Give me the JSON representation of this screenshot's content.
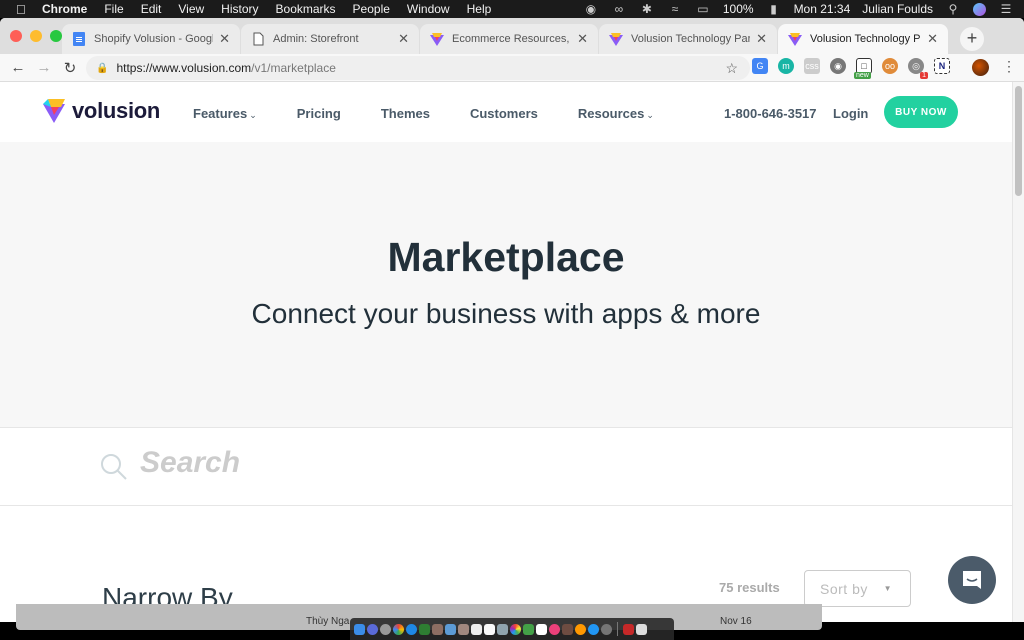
{
  "menubar": {
    "app_name": "Chrome",
    "menus": [
      "File",
      "Edit",
      "View",
      "History",
      "Bookmarks",
      "People",
      "Window",
      "Help"
    ],
    "battery": "100%",
    "clock": "Mon 21:34",
    "user": "Julian Foulds"
  },
  "browser": {
    "tabs": [
      {
        "title": "Shopify Volusion - Google Docs",
        "favicon": "google-docs-icon",
        "active": false
      },
      {
        "title": "Admin: Storefront",
        "favicon": "page-icon",
        "active": false
      },
      {
        "title": "Ecommerce Resources, Training",
        "favicon": "volusion-icon",
        "active": false
      },
      {
        "title": "Volusion Technology Partners",
        "favicon": "volusion-icon",
        "active": false
      },
      {
        "title": "Volusion Technology Partners",
        "favicon": "volusion-icon",
        "active": true
      }
    ],
    "new_tab_label": "+",
    "url_host": "https://www.volusion.com",
    "url_path": "/v1/marketplace",
    "extension_badge": "1",
    "extension_new_label": "new"
  },
  "site": {
    "logo_text": "volusion",
    "nav": [
      {
        "label": "Features",
        "dropdown": true
      },
      {
        "label": "Pricing",
        "dropdown": false
      },
      {
        "label": "Themes",
        "dropdown": false
      },
      {
        "label": "Customers",
        "dropdown": false
      },
      {
        "label": "Resources",
        "dropdown": true
      }
    ],
    "phone": "1-800-646-3517",
    "login_label": "Login",
    "cta_label": "BUY NOW",
    "accent_color": "#22d1a0"
  },
  "hero": {
    "title": "Marketplace",
    "subtitle": "Connect your business with apps & more"
  },
  "search": {
    "placeholder": "Search",
    "value": ""
  },
  "listing": {
    "filters_heading": "Narrow By",
    "results_count": "75 results",
    "sort_placeholder": "Sort by"
  },
  "background_window": {
    "partial_text_1": "Thùy Nga",
    "partial_text_2": "Nov 16"
  }
}
